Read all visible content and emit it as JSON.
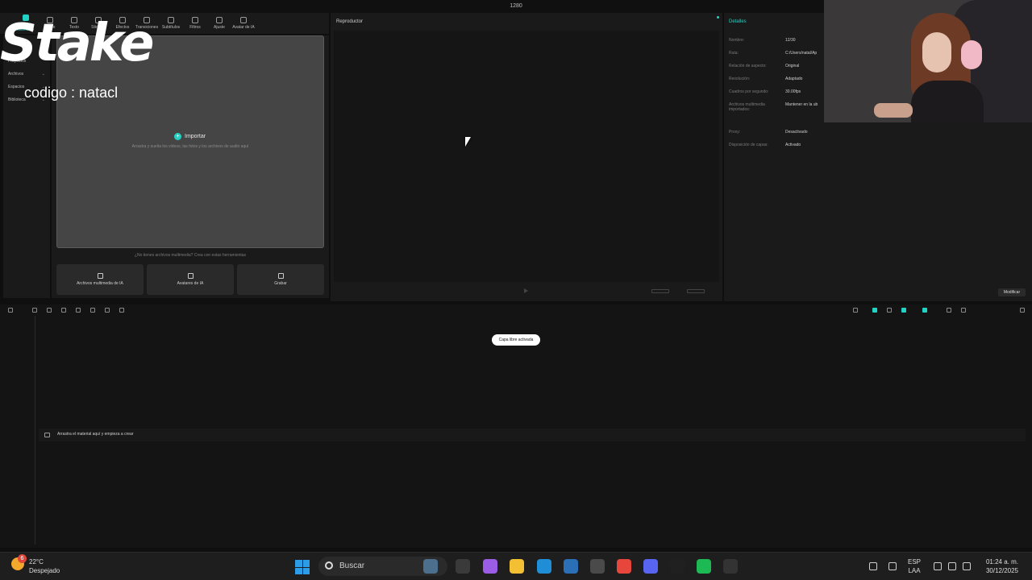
{
  "window": {
    "title": "1280"
  },
  "toolbar": {
    "tabs": [
      {
        "label": "Archivos multimedia",
        "active": true
      },
      {
        "label": "Audio"
      },
      {
        "label": "Texto"
      },
      {
        "label": "Stickers"
      },
      {
        "label": "Efectos"
      },
      {
        "label": "Transiciones"
      },
      {
        "label": "Subtítulos"
      },
      {
        "label": "Filtros"
      },
      {
        "label": "Ajuste"
      },
      {
        "label": "Avatar de IA"
      }
    ]
  },
  "left_nav": {
    "items": [
      {
        "label": "Proyectos"
      },
      {
        "label": "Archivos"
      },
      {
        "label": "Espacios"
      },
      {
        "label": "Biblioteca"
      }
    ]
  },
  "media": {
    "import_label": "Importar",
    "import_hint": "Arrastra y suelta los videos, las fotos y los archivos de audio aquí",
    "no_files_text": "¿No tienes archivos multimedia? Crea con estas herramientas",
    "create": [
      {
        "label": "Archivos multimedia de IA"
      },
      {
        "label": "Avatares de IA"
      },
      {
        "label": "Grabar"
      }
    ]
  },
  "player": {
    "title": "Reproductor"
  },
  "details": {
    "title": "Detalles",
    "rows": [
      {
        "key": "Nombre:",
        "value": "12/30"
      },
      {
        "key": "Ruta:",
        "value": "C:/Users/natal/Ap"
      },
      {
        "key": "Relación de aspecto:",
        "value": "Original"
      },
      {
        "key": "Resolución:",
        "value": "Adaptado"
      },
      {
        "key": "Cuadros por segundo:",
        "value": "30.00fps"
      },
      {
        "key": "Archivos multimedia importados:",
        "value": "Mantener en la ub"
      },
      {
        "key": "Proxy:",
        "value": "Desactivado"
      },
      {
        "key": "Disposición de capas:",
        "value": "Activado"
      }
    ],
    "modify_label": "Modificar"
  },
  "timeline": {
    "badge": "Capa libre activada",
    "drop_text": "Arrastra el material aquí y empieza a crear"
  },
  "overlay": {
    "brand": "Stake",
    "code": "codigo : natacl"
  },
  "taskbar": {
    "badge_count": "6",
    "temp": "22°C",
    "weather": "Despejado",
    "search_placeholder": "Buscar",
    "lang": "ESP",
    "lang2": "LAA",
    "time": "01:24 a. m.",
    "date": "30/12/2025"
  },
  "colors": {
    "accent": "#22d3c5",
    "background": "#1a1a1b"
  }
}
